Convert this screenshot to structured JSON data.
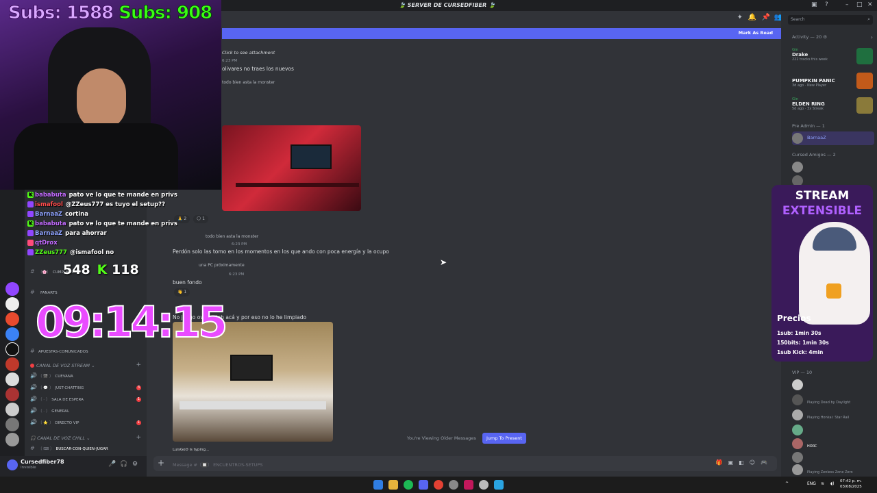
{
  "window": {
    "title": "🍃 SERVER DE CURSEDFIBER 🍃",
    "search_placeholder": "Search"
  },
  "banner": {
    "mark_as_read": "Mark As Read"
  },
  "channels": {
    "top_items": [
      {
        "tag": "〔🌸〕",
        "label": "CUMPLEAÑOS"
      },
      {
        "tag": "",
        "label": "FANARTS"
      },
      {
        "tag": "〔⚫〕",
        "label": "APUESTAS-COMUNICADOS"
      }
    ],
    "voice_category": "CANAL DE VOZ STREAM",
    "voice": [
      {
        "tag": "〔 🎬 〕",
        "label": "CUEVANA",
        "count": ""
      },
      {
        "tag": "〔 💬 〕",
        "label": "JUST-CHATTING",
        "count": "3"
      },
      {
        "tag": "〔 · 〕",
        "label": "SALA DE ESPERA",
        "count": "1"
      },
      {
        "tag": "〔 · 〕",
        "label": "GENERAL",
        "count": ""
      },
      {
        "tag": "〔 ⭐ 〕",
        "label": "DIRECTO VIP",
        "count": "1"
      }
    ],
    "chill_category": "CANAL DE VOZ CHILL",
    "chill": [
      {
        "tag": "〔 ⌨ 〕",
        "label": "BUSCAR-CON-QUIEN-JUGAR"
      }
    ]
  },
  "user": {
    "name": "Cursedfiber78",
    "status": "Invisible"
  },
  "messages": {
    "attachment": "Click to see attachment",
    "time1": "6:23 PM",
    "m1": "olivares no traes los nuevos",
    "reply1": "todo bien asta la monster",
    "react1a": "2",
    "react1b": "1",
    "reply2": "todo bien asta la monster",
    "time2": "6:23 PM",
    "m2": "Perdón solo las tomo en los momentos en los que ando con poca energía y la ocupo",
    "reply3": "una PC próximamente",
    "time3": "6:23 PM",
    "m3": "buen fondo",
    "react3": "1",
    "time4": "6:24 PM",
    "m4": "No juego overwatch acá y por eso no lo he limpiado",
    "older": "You're Viewing Older Messages",
    "jump": "Jump To Present",
    "typing": "LuisGoD is typing...",
    "placeholder": "Message #〔🔲〕 ENCUENTROS-SETUPS"
  },
  "activity": {
    "title": "Activity — 20",
    "items": [
      {
        "who": "Gin",
        "game": "Drake",
        "sub": "222 tracks this week",
        "color": "#1f6f3f"
      },
      {
        "who": "",
        "game": "PUMPKIN PANIC",
        "sub": "3d ago · New Player",
        "color": "#c25a1a"
      },
      {
        "who": "Gin",
        "game": "ELDEN RING",
        "sub": "5d ago · 3x Streak",
        "color": "#8a7a3a"
      }
    ]
  },
  "roles": {
    "pre_admin": "Pre Admin — 1",
    "pre_admin_member": "BarnaaZ",
    "cursed": "Cursed Amigos — 2",
    "vip": "VIP — 10",
    "vip_members": [
      {
        "act": ""
      },
      {
        "act": "Playing Dead by Daylight"
      },
      {
        "act": "Playing Honkai: Star Rail"
      },
      {
        "act": ""
      },
      {
        "act": "HORC"
      },
      {
        "act": ""
      },
      {
        "act": "Playing Zenless Zone Zero"
      }
    ]
  },
  "overlay": {
    "subs_a": "Subs: 1588",
    "subs_b": "Subs: 908",
    "chat": [
      {
        "user": "bababuta",
        "color": "#c36bff",
        "text": "pato ve lo que te mande en privs"
      },
      {
        "user": "ismafool",
        "color": "#ff4b4b",
        "text": "@ZZeus777 es tuyo el setup??"
      },
      {
        "user": "BarnaaZ",
        "color": "#8fa3ff",
        "text": "cortina"
      },
      {
        "user": "bababuta",
        "color": "#c36bff",
        "text": "pato ve lo que te mande en privs"
      },
      {
        "user": "BarnaaZ",
        "color": "#8fa3ff",
        "text": "para ahorrar"
      },
      {
        "user": "qtDrox",
        "color": "#c36bff",
        "text": ""
      },
      {
        "user": "ZZeus777",
        "color": "#53fc18",
        "text": "@ismafool no"
      }
    ],
    "viewers_twitch": "548",
    "viewers_kick": "118",
    "timer": "09:14:15",
    "card_title1": "STREAM",
    "card_title2": "EXTENSIBLE",
    "prices_title": "Precios",
    "prices": [
      "1sub: 1min 30s",
      "150bits: 1min 30s",
      "1sub Kick: 4min"
    ]
  },
  "taskbar": {
    "lang": "ENG",
    "time": "07:42 p. m.",
    "date": "03/08/2025"
  }
}
